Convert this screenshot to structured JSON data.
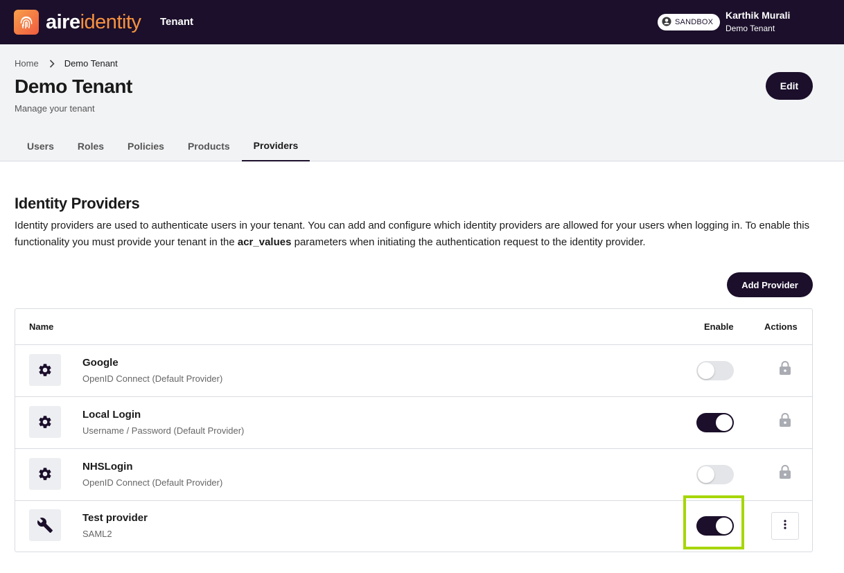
{
  "topbar": {
    "logo_part1": "aire",
    "logo_part2": "identity",
    "nav_title": "Tenant",
    "sandbox_label": "SANDBOX",
    "user_name": "Karthik Murali",
    "user_tenant": "Demo Tenant"
  },
  "breadcrumb": {
    "home": "Home",
    "current": "Demo Tenant"
  },
  "header": {
    "title": "Demo Tenant",
    "subtitle": "Manage your tenant",
    "edit_label": "Edit"
  },
  "tabs": [
    {
      "label": "Users"
    },
    {
      "label": "Roles"
    },
    {
      "label": "Policies"
    },
    {
      "label": "Products"
    },
    {
      "label": "Providers",
      "active": true
    }
  ],
  "section": {
    "title": "Identity Providers",
    "desc_part1": "Identity providers are used to authenticate users in your tenant. You can add and configure which identity providers are allowed for your users when logging in. To enable this functionality you must provide your tenant in the ",
    "desc_bold": "acr_values",
    "desc_part2": " parameters when initiating the authentication request to the identity provider.",
    "add_label": "Add Provider"
  },
  "table": {
    "headers": {
      "name": "Name",
      "enable": "Enable",
      "actions": "Actions"
    },
    "rows": [
      {
        "name": "Google",
        "type": "OpenID Connect (Default Provider)",
        "icon": "gear-icon",
        "enabled": false,
        "action": "lock-icon"
      },
      {
        "name": "Local Login",
        "type": "Username / Password (Default Provider)",
        "icon": "gear-icon",
        "enabled": true,
        "action": "lock-icon"
      },
      {
        "name": "NHSLogin",
        "type": "OpenID Connect (Default Provider)",
        "icon": "gear-icon",
        "enabled": false,
        "action": "lock-icon"
      },
      {
        "name": "Test provider",
        "type": "SAML2",
        "icon": "wrench-icon",
        "enabled": true,
        "action": "more-vertical-icon"
      }
    ]
  },
  "colors": {
    "primary": "#1b0f2b",
    "brand_orange": "#f7923f",
    "highlight": "#a6d608"
  }
}
